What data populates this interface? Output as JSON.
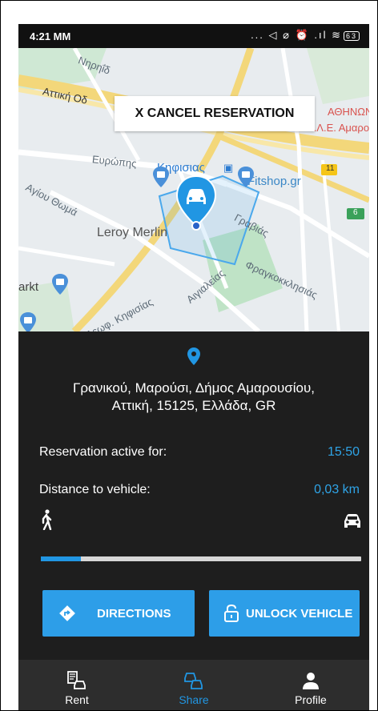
{
  "status_bar": {
    "time": "4:21 MM",
    "icons": "... ◁ ⌀ ⏰ .ıl ≋",
    "battery": "63"
  },
  "map": {
    "cancel_button": "X CANCEL RESERVATION",
    "street_labels": [
      "Νηρηΐδ",
      "Αττική Οδ",
      "Ευρώπης",
      "Αγίου Θωμά",
      "Γραβιάς",
      "Φραγκοκκλησιάς",
      "Αιγιαλείας",
      "Λεωφ. Κηφισίας"
    ],
    "poi_labels": {
      "kifisias": "Κηφισιας",
      "fitshop": "Fitshop.gr",
      "leroy": "Leroy Merlin",
      "markt": "arkt",
      "athinon": "ΑΘΗΝΩΝ",
      "eae": "Ε.Λ.Ε. Αμαρουσίο",
      "road11": "11",
      "road6": "6"
    }
  },
  "reservation": {
    "address_line1": "Γρανικού, Μαρούσι, Δήμος Αμαρουσίου,",
    "address_line2": "Αττική, 15125, Ελλάδα, GR",
    "active_label": "Reservation active for:",
    "active_value": "15:50",
    "distance_label": "Distance to vehicle:",
    "distance_value": "0,03 km",
    "progress_fraction": 0.125
  },
  "actions": {
    "directions": "DIRECTIONS",
    "unlock": "UNLOCK VEHICLE"
  },
  "nav": {
    "rent": "Rent",
    "share": "Share",
    "profile": "Profile",
    "active": "share"
  },
  "colors": {
    "accent": "#2196e3",
    "panel_bg": "#1e1e1e",
    "nav_bg": "#2d2d2d"
  }
}
